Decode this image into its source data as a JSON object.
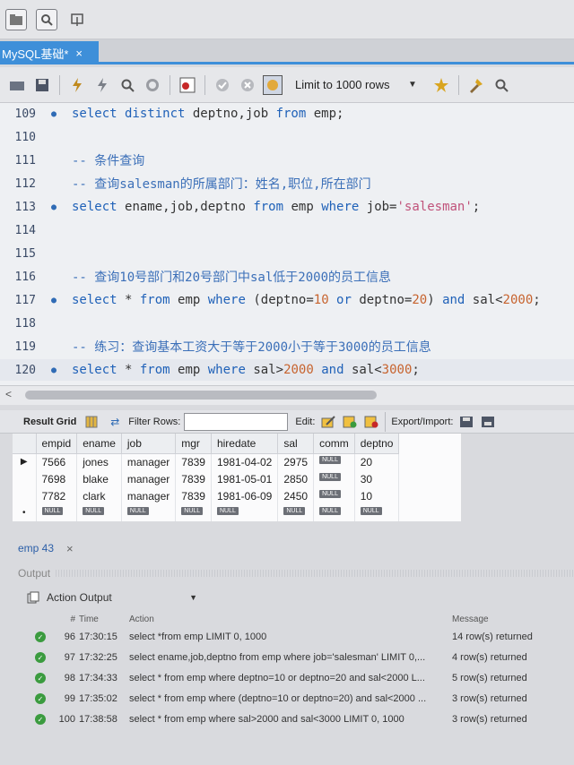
{
  "toolbar": {
    "icons": [
      "folder-icon",
      "search-window-icon",
      "settings-download-icon"
    ]
  },
  "tab": {
    "label": "MySQL基础*",
    "close": "×"
  },
  "editor_toolbar": {
    "limit_label": "Limit to 1000 rows"
  },
  "editor": {
    "lines": [
      {
        "num": "109",
        "dot": true,
        "parts": [
          [
            "kw",
            "select distinct "
          ],
          [
            "",
            "deptno,job "
          ],
          [
            "kw",
            "from"
          ],
          [
            "",
            " emp;"
          ]
        ]
      },
      {
        "num": "110",
        "dot": false,
        "parts": []
      },
      {
        "num": "111",
        "dot": false,
        "parts": [
          [
            "cm",
            "-- 条件查询"
          ]
        ]
      },
      {
        "num": "112",
        "dot": false,
        "parts": [
          [
            "cm",
            "-- 查询salesman的所属部门：姓名,职位,所在部门"
          ]
        ]
      },
      {
        "num": "113",
        "dot": true,
        "parts": [
          [
            "kw",
            "select "
          ],
          [
            "",
            "ename,job,deptno "
          ],
          [
            "kw",
            "from"
          ],
          [
            "",
            " emp "
          ],
          [
            "kw",
            "where"
          ],
          [
            "",
            " job="
          ],
          [
            "str",
            "'salesman'"
          ],
          [
            "",
            ";"
          ]
        ]
      },
      {
        "num": "114",
        "dot": false,
        "parts": []
      },
      {
        "num": "115",
        "dot": false,
        "parts": []
      },
      {
        "num": "116",
        "dot": false,
        "parts": [
          [
            "cm",
            "-- 查询10号部门和20号部门中sal低于2000的员工信息"
          ]
        ]
      },
      {
        "num": "117",
        "dot": true,
        "parts": [
          [
            "kw",
            "select"
          ],
          [
            "",
            " * "
          ],
          [
            "kw",
            "from"
          ],
          [
            "",
            " emp "
          ],
          [
            "kw",
            "where"
          ],
          [
            "",
            " (deptno="
          ],
          [
            "num",
            "10"
          ],
          [
            "kw",
            " or "
          ],
          [
            "",
            "deptno="
          ],
          [
            "num",
            "20"
          ],
          [
            "",
            ") "
          ],
          [
            "kw",
            "and"
          ],
          [
            "",
            " sal<"
          ],
          [
            "num",
            "2000"
          ],
          [
            "",
            ";"
          ]
        ]
      },
      {
        "num": "118",
        "dot": false,
        "parts": []
      },
      {
        "num": "119",
        "dot": false,
        "parts": [
          [
            "cm",
            "-- 练习：查询基本工资大于等于2000小于等于3000的员工信息"
          ]
        ]
      },
      {
        "num": "120",
        "dot": true,
        "parts": [
          [
            "kw",
            "select"
          ],
          [
            "",
            " * "
          ],
          [
            "kw",
            "from"
          ],
          [
            "",
            " emp "
          ],
          [
            "kw",
            "where"
          ],
          [
            "",
            " sal>"
          ],
          [
            "num",
            "2000"
          ],
          [
            "kw",
            " and "
          ],
          [
            "",
            "sal<"
          ],
          [
            "num",
            "3000"
          ],
          [
            "",
            ";"
          ]
        ]
      }
    ]
  },
  "result_toolbar": {
    "result_grid": "Result Grid",
    "filter_rows": "Filter Rows:",
    "edit": "Edit:",
    "export_import": "Export/Import:"
  },
  "grid": {
    "columns": [
      "empid",
      "ename",
      "job",
      "mgr",
      "hiredate",
      "sal",
      "comm",
      "deptno"
    ],
    "rows": [
      {
        "marker": "▶",
        "cells": [
          "7566",
          "jones",
          "manager",
          "7839",
          "1981-04-02",
          "2975",
          "NULL",
          "20"
        ]
      },
      {
        "marker": "",
        "cells": [
          "7698",
          "blake",
          "manager",
          "7839",
          "1981-05-01",
          "2850",
          "NULL",
          "30"
        ]
      },
      {
        "marker": "",
        "cells": [
          "7782",
          "clark",
          "manager",
          "7839",
          "1981-06-09",
          "2450",
          "NULL",
          "10"
        ]
      },
      {
        "marker": "•",
        "cells": [
          "NULL",
          "NULL",
          "NULL",
          "NULL",
          "NULL",
          "NULL",
          "NULL",
          "NULL"
        ]
      }
    ]
  },
  "result_tab": {
    "label": "emp 43",
    "close": "×"
  },
  "output": {
    "title": "Output",
    "selector": "Action Output",
    "headers": {
      "num": "#",
      "time": "Time",
      "action": "Action",
      "message": "Message"
    },
    "rows": [
      {
        "num": "96",
        "time": "17:30:15",
        "action": "select *from emp LIMIT 0, 1000",
        "message": "14 row(s) returned"
      },
      {
        "num": "97",
        "time": "17:32:25",
        "action": "select ename,job,deptno from emp where job='salesman' LIMIT 0,...",
        "message": "4 row(s) returned"
      },
      {
        "num": "98",
        "time": "17:34:33",
        "action": "select * from emp where deptno=10 or deptno=20 and sal<2000 L...",
        "message": "5 row(s) returned"
      },
      {
        "num": "99",
        "time": "17:35:02",
        "action": "select * from emp where (deptno=10 or deptno=20) and sal<2000 ...",
        "message": "3 row(s) returned"
      },
      {
        "num": "100",
        "time": "17:38:58",
        "action": "select * from emp where sal>2000 and sal<3000 LIMIT 0, 1000",
        "message": "3 row(s) returned"
      }
    ]
  }
}
